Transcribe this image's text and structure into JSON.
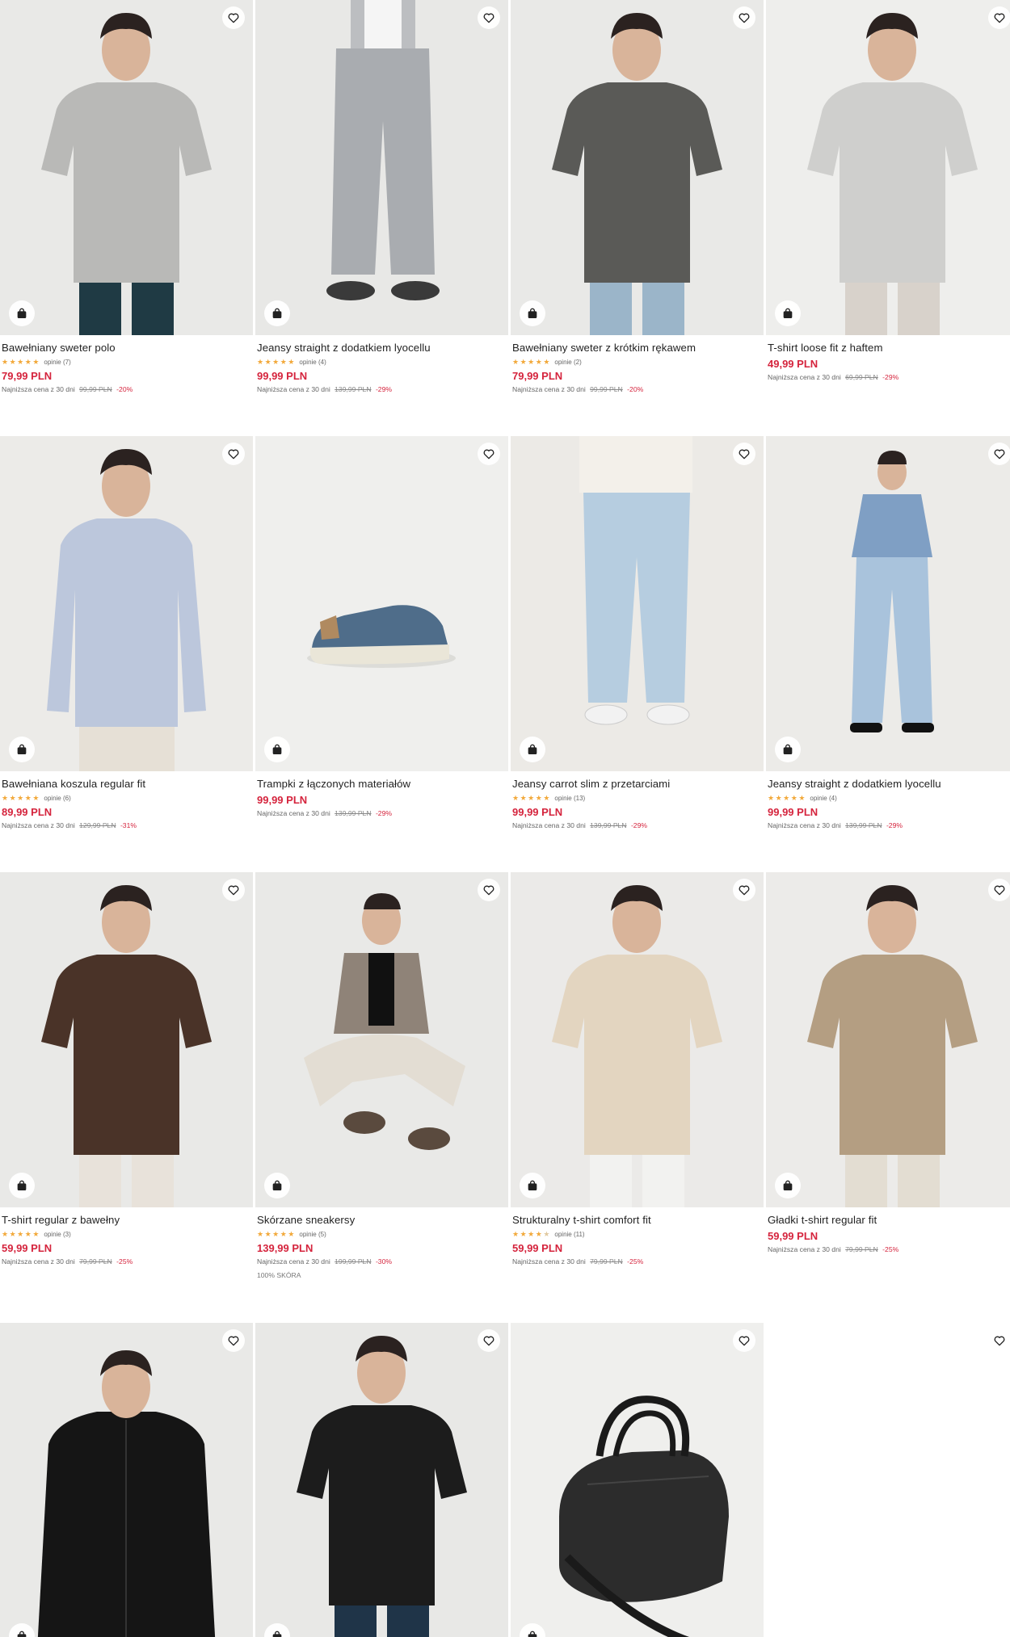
{
  "colors": {
    "price": "#d5243d",
    "star": "#f2a93b",
    "image_bg": "#ececea"
  },
  "icons": {
    "favorite": "heart-outline-icon",
    "add_to_cart": "shopping-bag-icon",
    "rating": "star-icon"
  },
  "products": [
    {
      "name": "Bawełniany sweter polo",
      "rating": 5,
      "reviews": "opinie (7)",
      "price": "79,99 PLN",
      "lowest_label": "Najniższa cena z 30 dni",
      "old_price": "99,99 PLN",
      "discount": "-20%"
    },
    {
      "name": "Jeansy straight z dodatkiem lyocellu",
      "rating": 5,
      "reviews": "opinie (4)",
      "price": "99,99 PLN",
      "lowest_label": "Najniższa cena z 30 dni",
      "old_price": "139,99 PLN",
      "discount": "-29%"
    },
    {
      "name": "Bawełniany sweter z krótkim rękawem",
      "rating": 5,
      "reviews": "opinie (2)",
      "price": "79,99 PLN",
      "lowest_label": "Najniższa cena z 30 dni",
      "old_price": "99,99 PLN",
      "discount": "-20%"
    },
    {
      "name": "T-shirt loose fit z haftem",
      "rating": null,
      "reviews": "",
      "price": "49,99 PLN",
      "lowest_label": "Najniższa cena z 30 dni",
      "old_price": "69,99 PLN",
      "discount": "-29%"
    },
    {
      "name": "Bawełniana koszula regular fit",
      "rating": 5,
      "reviews": "opinie (6)",
      "price": "89,99 PLN",
      "lowest_label": "Najniższa cena z 30 dni",
      "old_price": "129,99 PLN",
      "discount": "-31%"
    },
    {
      "name": "Trampki z łączonych materiałów",
      "rating": null,
      "reviews": "",
      "price": "99,99 PLN",
      "lowest_label": "Najniższa cena z 30 dni",
      "old_price": "139,99 PLN",
      "discount": "-29%"
    },
    {
      "name": "Jeansy carrot slim z przetarciami",
      "rating": 5,
      "reviews": "opinie (13)",
      "price": "99,99 PLN",
      "lowest_label": "Najniższa cena z 30 dni",
      "old_price": "139,99 PLN",
      "discount": "-29%"
    },
    {
      "name": "Jeansy straight z dodatkiem lyocellu",
      "rating": 5,
      "reviews": "opinie (4)",
      "price": "99,99 PLN",
      "lowest_label": "Najniższa cena z 30 dni",
      "old_price": "139,99 PLN",
      "discount": "-29%"
    },
    {
      "name": "T-shirt regular z bawełny",
      "rating": 5,
      "reviews": "opinie (3)",
      "price": "59,99 PLN",
      "lowest_label": "Najniższa cena z 30 dni",
      "old_price": "79,99 PLN",
      "discount": "-25%"
    },
    {
      "name": "Skórzane sneakersy",
      "rating": 5,
      "reviews": "opinie (5)",
      "price": "139,99 PLN",
      "lowest_label": "Najniższa cena z 30 dni",
      "old_price": "199,99 PLN",
      "discount": "-30%",
      "note": "100% SKÓRA"
    },
    {
      "name": "Strukturalny t-shirt comfort fit",
      "rating": 4.5,
      "reviews": "opinie (11)",
      "price": "59,99 PLN",
      "lowest_label": "Najniższa cena z 30 dni",
      "old_price": "79,99 PLN",
      "discount": "-25%"
    },
    {
      "name": "Gładki t-shirt regular fit",
      "rating": null,
      "reviews": "",
      "price": "59,99 PLN",
      "lowest_label": "Najniższa cena z 30 dni",
      "old_price": "79,99 PLN",
      "discount": "-25%"
    },
    {
      "name": "",
      "rating": null,
      "reviews": "",
      "price": "",
      "lowest_label": "",
      "old_price": "",
      "discount": ""
    },
    {
      "name": "",
      "rating": null,
      "reviews": "",
      "price": "",
      "lowest_label": "",
      "old_price": "",
      "discount": ""
    },
    {
      "name": "",
      "rating": null,
      "reviews": "",
      "price": "",
      "lowest_label": "",
      "old_price": "",
      "discount": ""
    },
    {
      "name": "",
      "rating": null,
      "reviews": "",
      "price": "",
      "lowest_label": "",
      "old_price": "",
      "discount": ""
    }
  ]
}
